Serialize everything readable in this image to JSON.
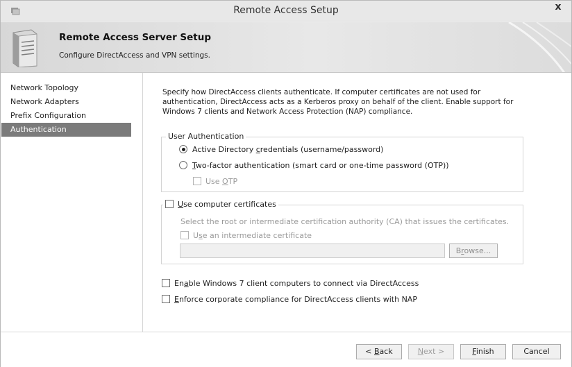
{
  "window": {
    "title": "Remote Access Setup",
    "close": "x"
  },
  "banner": {
    "title": "Remote Access Server Setup",
    "subtitle": "Configure DirectAccess and VPN settings."
  },
  "nav": {
    "items": [
      {
        "label": "Network Topology",
        "active": false
      },
      {
        "label": "Network Adapters",
        "active": false
      },
      {
        "label": "Prefix Configuration",
        "active": false
      },
      {
        "label": "Authentication",
        "active": true
      }
    ]
  },
  "content": {
    "description": "Specify how DirectAccess clients authenticate. If computer certificates are not used for authentication, DirectAccess acts as a Kerberos proxy on behalf of the client. Enable support for Windows 7 clients and Network Access Protection (NAP) compliance.",
    "user_auth": {
      "legend": "User Authentication",
      "option_ad_pre": "Active Directory ",
      "option_ad_key": "c",
      "option_ad_post": "redentials (username/password)",
      "option_2fa_key": "T",
      "option_2fa_post": "wo-factor authentication (smart card or one-time password (OTP))",
      "use_otp_pre": "Use ",
      "use_otp_key": "O",
      "use_otp_post": "TP",
      "selected": "active-directory"
    },
    "certs": {
      "legend_key": "U",
      "legend_post": "se computer certificates",
      "hint": "Select the root or intermediate certification authority (CA) that issues the certificates.",
      "intermediate_pre": "U",
      "intermediate_key": "s",
      "intermediate_post": "e an intermediate certificate",
      "path_value": "",
      "browse_pre": "B",
      "browse_key": "r",
      "browse_post": "owse..."
    },
    "win7_pre": "En",
    "win7_key": "a",
    "win7_post": "ble Windows 7 client computers to connect via DirectAccess",
    "nap_key": "E",
    "nap_post": "nforce corporate compliance for DirectAccess clients with NAP"
  },
  "footer": {
    "back_pre": "< ",
    "back_key": "B",
    "back_post": "ack",
    "next_key": "N",
    "next_post": "ext >",
    "finish_key": "F",
    "finish_post": "inish",
    "cancel": "Cancel"
  }
}
